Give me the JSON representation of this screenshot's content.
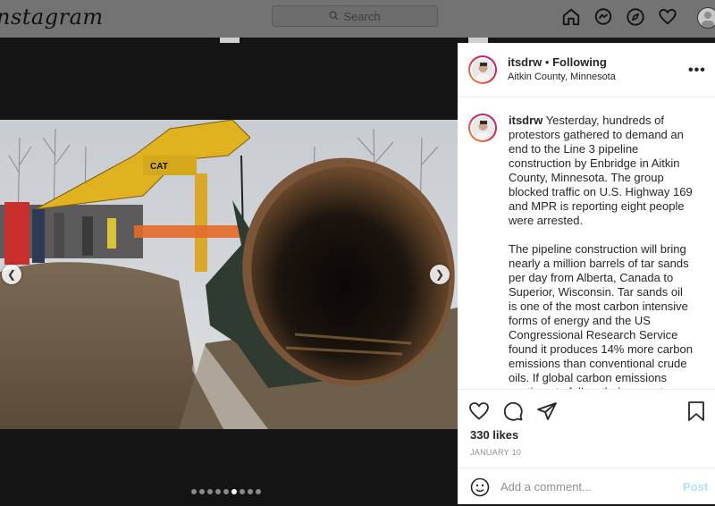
{
  "topbar": {
    "logo": "nstagram",
    "search_placeholder": "Search",
    "icons": [
      "home-icon",
      "messenger-icon",
      "explore-icon",
      "heart-icon",
      "profile-icon"
    ]
  },
  "carousel": {
    "dot_count": 9,
    "active_index": 5
  },
  "post": {
    "username": "itsdrw",
    "follow_status": "Following",
    "separator": "•",
    "location": "Aitkin County, Minnesota",
    "more_label": "•••",
    "caption_paragraph_1": "Yesterday, hundreds of protestors gathered to demand an end to the Line 3 pipeline construction by Enbridge in Aitkin County, Minnesota. The group blocked traffic on U.S. Highway 169 and MPR is reporting eight people were arrested.",
    "caption_paragraph_2": "The pipeline construction will bring nearly a million barrels of tar sands per day from Alberta, Canada to Superior, Wisconsin. Tar sands oil is one of the most carbon intensive forms of energy and the US Congressional Research Service found it produces 14% more carbon emissions than conventional crude oils. If global carbon emissions continue to follow their current trajectory, the global temperature will",
    "likes": "330 likes",
    "date": "JANUARY 10",
    "comment_placeholder": "Add a comment...",
    "post_label": "Post"
  },
  "colors": {
    "accent_link": "#b2dffc",
    "text": "#262626",
    "muted": "#8e8e8e"
  }
}
